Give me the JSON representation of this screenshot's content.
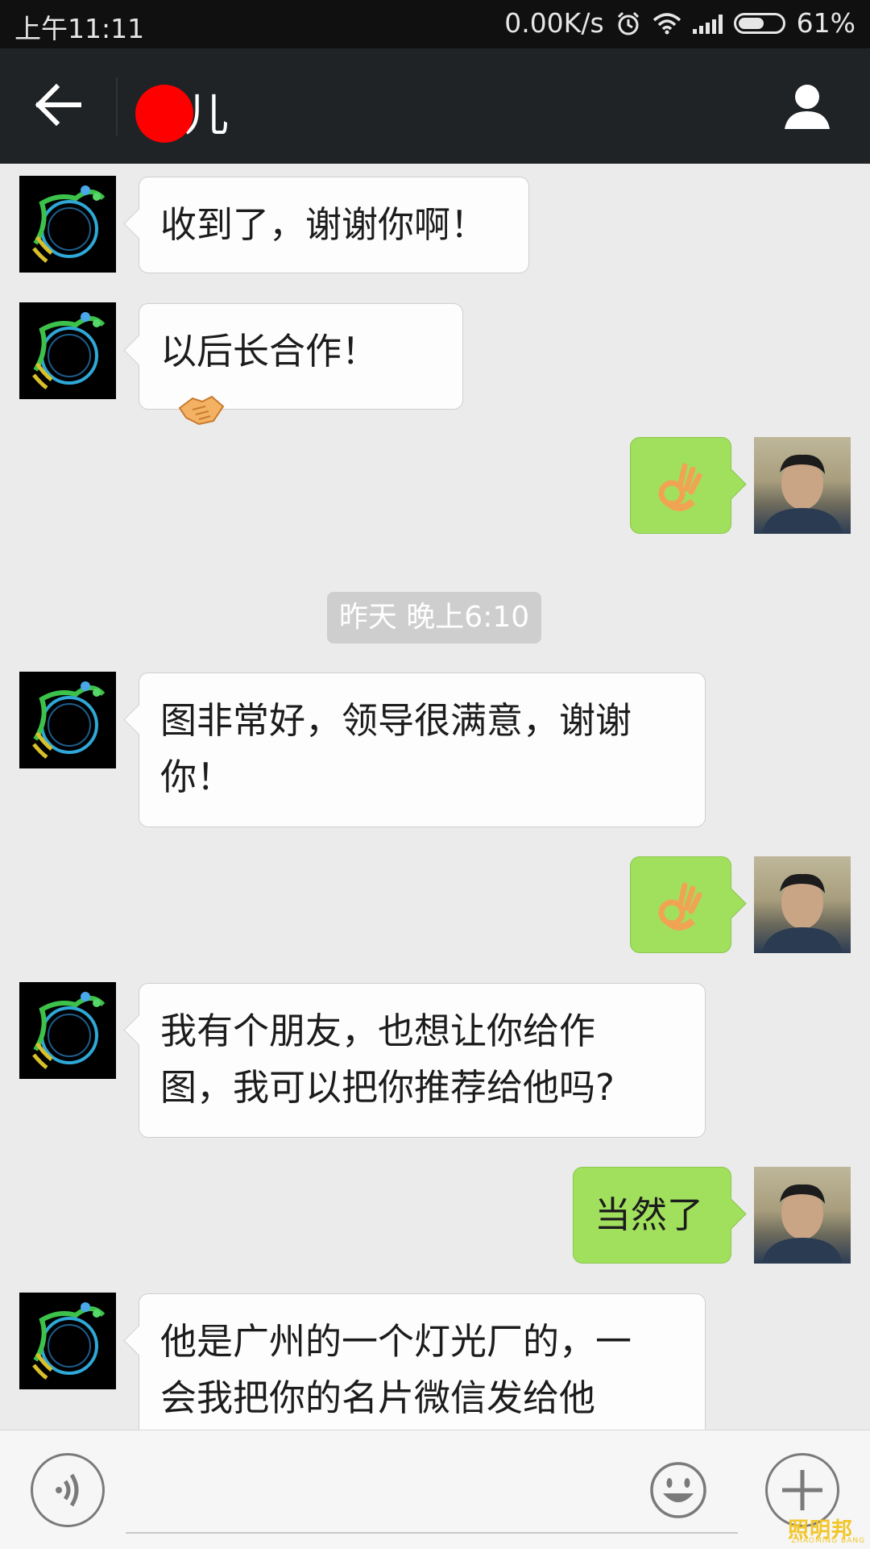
{
  "status_bar": {
    "time": "上午11:11",
    "speed": "0.00K/s",
    "battery": "61%",
    "battery_level": 0.61,
    "icons": [
      "alarm-icon",
      "wifi-icon",
      "signal-icon",
      "battery-icon"
    ]
  },
  "header": {
    "title": "丁儿",
    "back_icon": "arrow-left-icon",
    "profile_icon": "person-icon"
  },
  "messages": [
    {
      "side": "left",
      "text": "收到了，谢谢你啊！"
    },
    {
      "side": "left",
      "text": "以后长合作！",
      "emoji": "handshake-emoji"
    },
    {
      "side": "right",
      "emoji": "ok-hand-emoji"
    },
    {
      "type": "time",
      "text": "昨天 晚上6:10"
    },
    {
      "side": "left",
      "lines": [
        "图非常好，领导很满意，谢谢",
        "你！"
      ]
    },
    {
      "side": "right",
      "emoji": "ok-hand-emoji"
    },
    {
      "side": "left",
      "lines": [
        "我有个朋友，也想让你给作",
        "图，我可以把你推荐给他吗?"
      ]
    },
    {
      "side": "right",
      "text": "当然了"
    },
    {
      "side": "left",
      "lines": [
        "他是广州的一个灯光厂的，一",
        "会我把你的名片微信发给他"
      ]
    }
  ],
  "input_bar": {
    "voice_icon": "voice-icon",
    "emoji_icon": "smiley-icon",
    "plus_icon": "plus-icon",
    "text_value": ""
  },
  "watermark": {
    "text": "照明邦",
    "sub": "ZHAOMING BANG"
  },
  "colors": {
    "title_bar": "#1f2326",
    "chat_bg": "#ebebeb",
    "bubble_right": "#a1e05d",
    "bubble_left": "#fdfdfd",
    "redaction": "#ff0000"
  }
}
